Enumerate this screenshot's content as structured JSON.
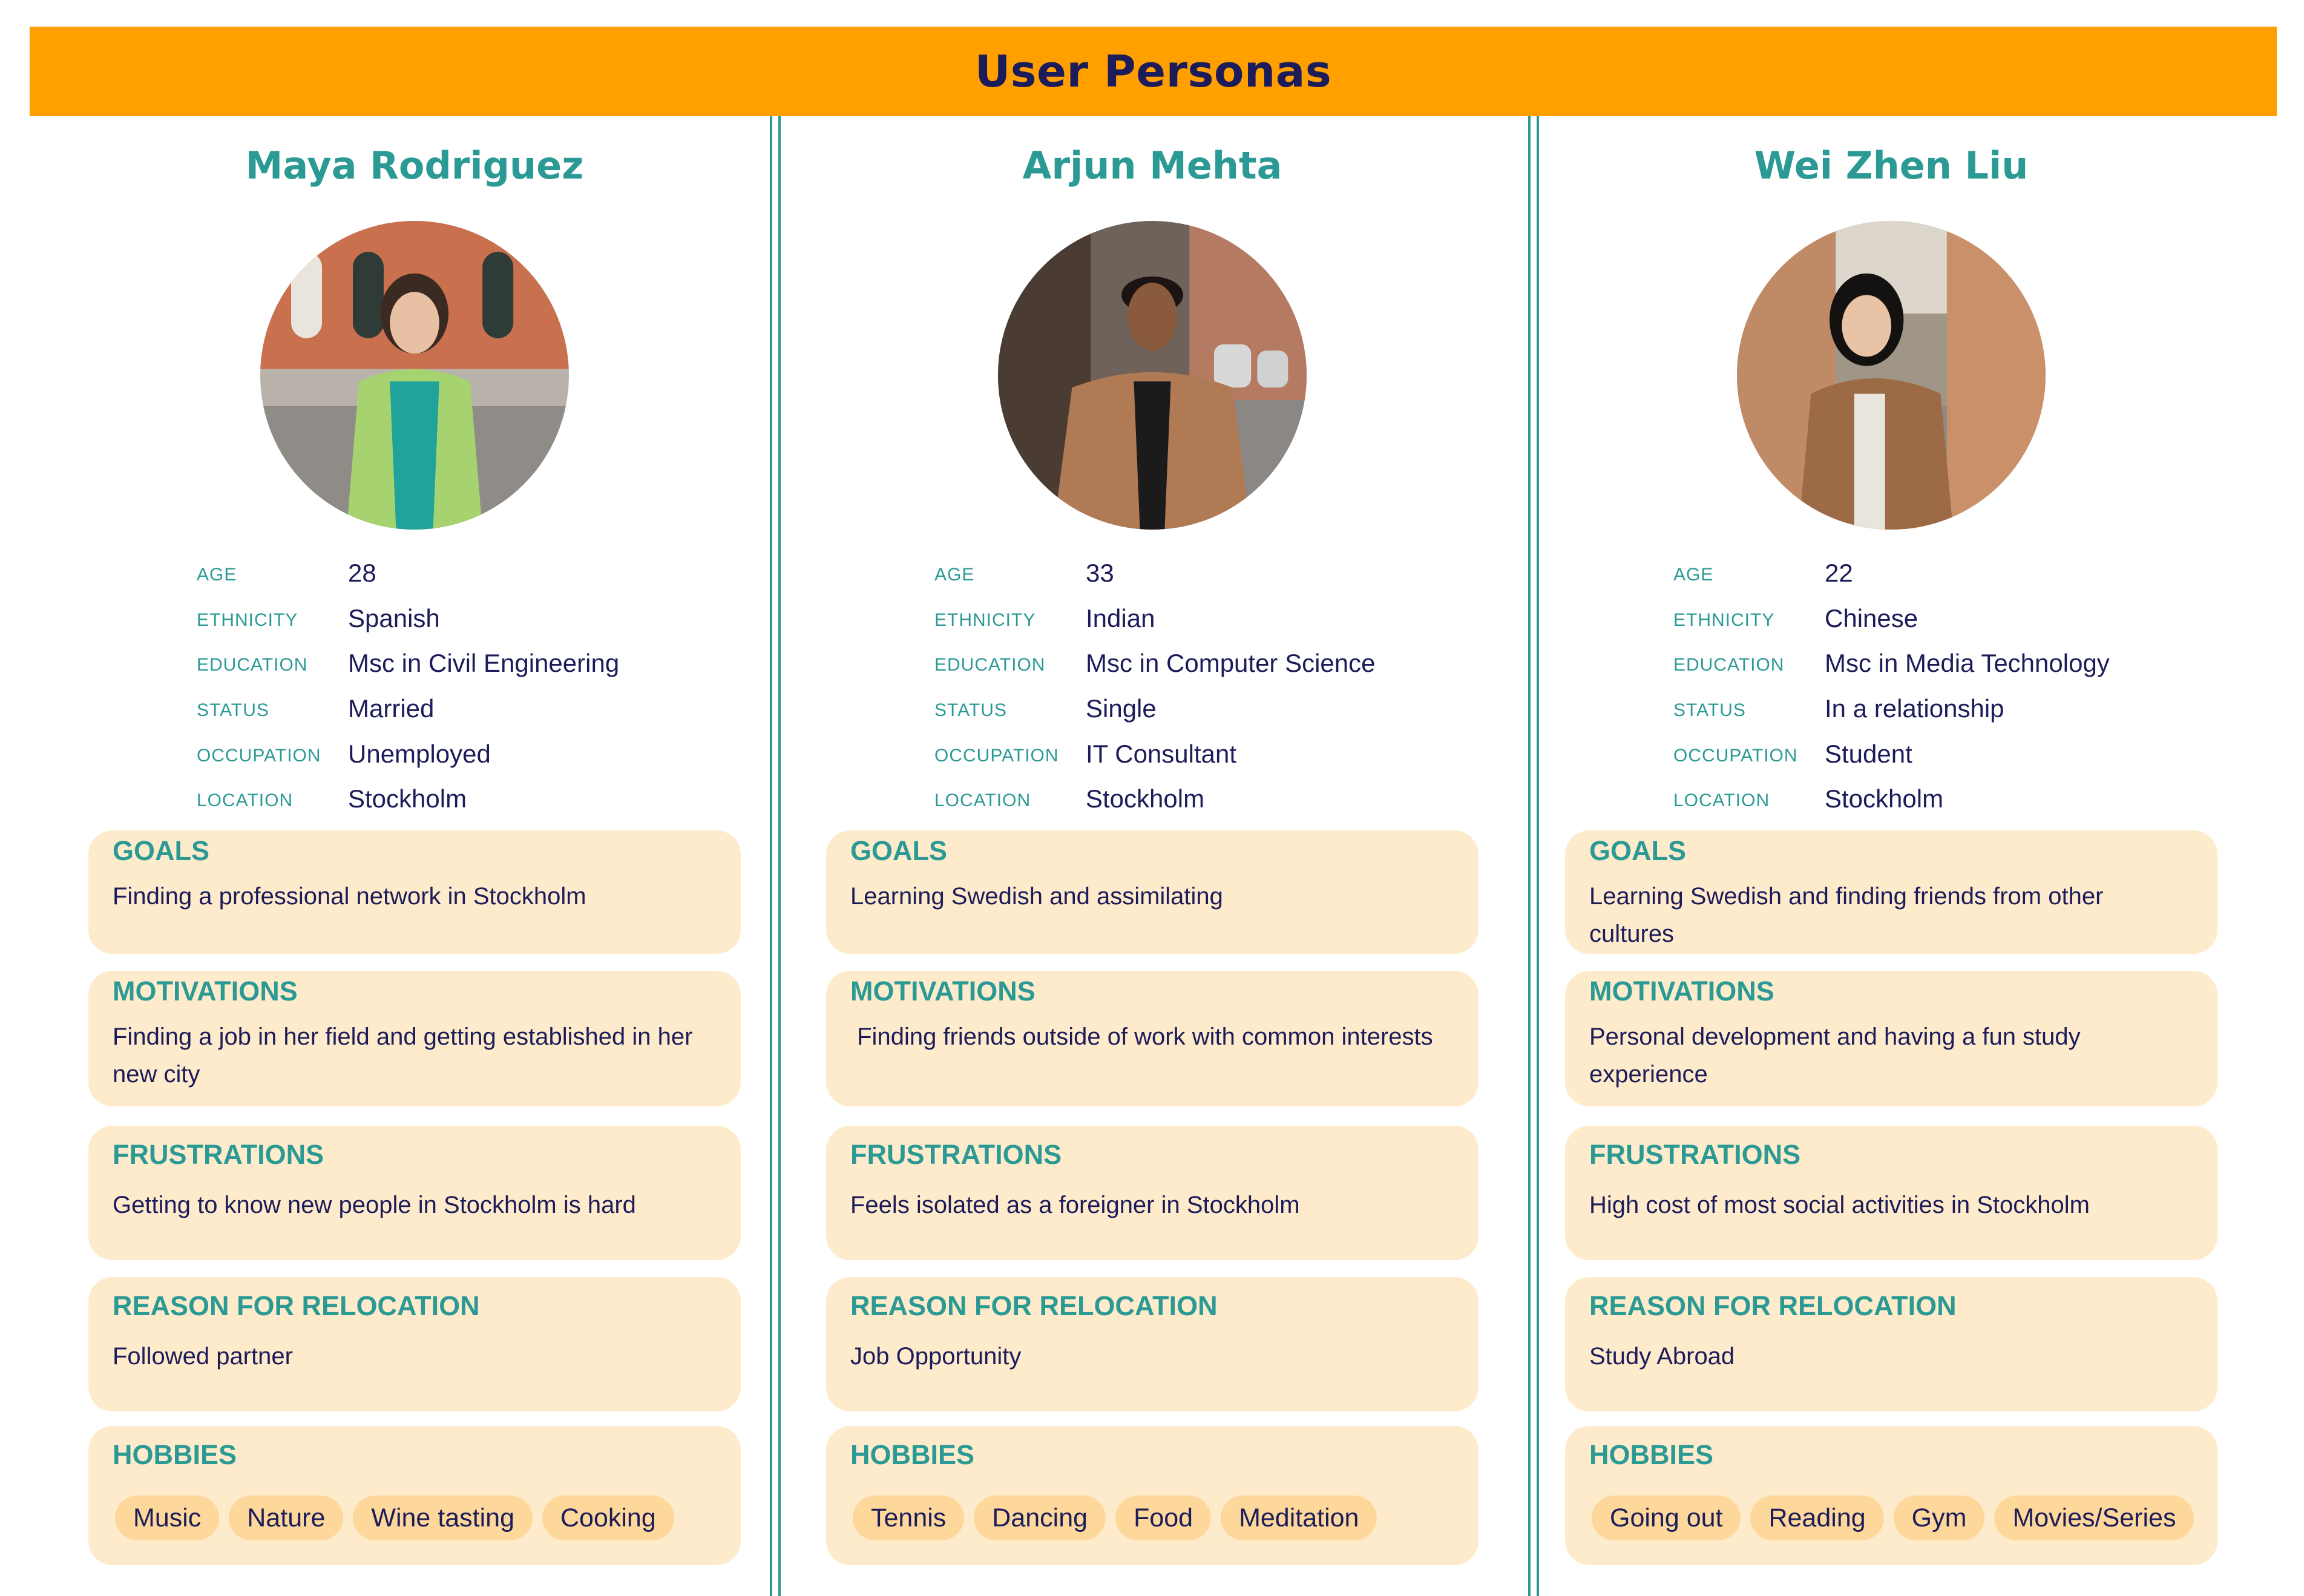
{
  "page": {
    "title": "User Personas",
    "colors": {
      "header_bg": "#ffa000",
      "accent": "#2b9a95",
      "card_bg": "#feebcb",
      "tag_bg": "#fdd89a",
      "text": "#1c1c5a"
    }
  },
  "personas": [
    {
      "name": "Maya Rodriguez",
      "avatar": "photo-woman-street",
      "facts": [
        {
          "label": "AGE",
          "value": "28"
        },
        {
          "label": "ETHNICITY",
          "value": "Spanish"
        },
        {
          "label": "EDUCATION",
          "value": "Msc in Civil Engineering"
        },
        {
          "label": "STATUS",
          "value": "Married"
        },
        {
          "label": "OCCUPATION",
          "value": "Unemployed"
        },
        {
          "label": "LOCATION",
          "value": "Stockholm"
        }
      ],
      "goals": {
        "title": "GOALS",
        "text": "Finding a professional network in Stockholm"
      },
      "motivations": {
        "title": "MOTIVATIONS",
        "text": "Finding a job in her field and getting established in her new city"
      },
      "frustrations": {
        "title": "FRUSTRATIONS",
        "text": "Getting to know new people in Stockholm is hard"
      },
      "relocation": {
        "title": "REASON FOR RELOCATION",
        "text": "Followed partner"
      },
      "hobbies": {
        "title": "HOBBIES",
        "items": [
          "Music",
          "Nature",
          "Wine tasting",
          "Cooking"
        ]
      }
    },
    {
      "name": "Arjun Mehta",
      "avatar": "photo-man-street",
      "facts": [
        {
          "label": "AGE",
          "value": "33"
        },
        {
          "label": "ETHNICITY",
          "value": "Indian"
        },
        {
          "label": "EDUCATION",
          "value": "Msc in Computer Science"
        },
        {
          "label": "STATUS",
          "value": "Single"
        },
        {
          "label": "OCCUPATION",
          "value": "IT Consultant"
        },
        {
          "label": "LOCATION",
          "value": "Stockholm"
        }
      ],
      "goals": {
        "title": "GOALS",
        "text": "Learning Swedish and assimilating"
      },
      "motivations": {
        "title": "MOTIVATIONS",
        "text": " Finding friends outside of work with common interests"
      },
      "frustrations": {
        "title": "FRUSTRATIONS",
        "text": "Feels isolated as a foreigner in Stockholm"
      },
      "relocation": {
        "title": "REASON FOR RELOCATION",
        "text": "Job Opportunity"
      },
      "hobbies": {
        "title": "HOBBIES",
        "items": [
          "Tennis",
          "Dancing",
          "Food",
          "Meditation"
        ]
      }
    },
    {
      "name": "Wei Zhen Liu",
      "avatar": "photo-woman-street",
      "facts": [
        {
          "label": "AGE",
          "value": "22"
        },
        {
          "label": "ETHNICITY",
          "value": "Chinese"
        },
        {
          "label": "EDUCATION",
          "value": "Msc in Media Technology"
        },
        {
          "label": "STATUS",
          "value": "In a relationship"
        },
        {
          "label": "OCCUPATION",
          "value": "Student"
        },
        {
          "label": "LOCATION",
          "value": "Stockholm"
        }
      ],
      "goals": {
        "title": "GOALS",
        "text": "Learning Swedish and finding friends from other cultures"
      },
      "motivations": {
        "title": "MOTIVATIONS",
        "text": "Personal development and having a fun study experience"
      },
      "frustrations": {
        "title": "FRUSTRATIONS",
        "text": "High cost of most social activities in Stockholm"
      },
      "relocation": {
        "title": "REASON FOR RELOCATION",
        "text": "Study Abroad"
      },
      "hobbies": {
        "title": "HOBBIES",
        "items": [
          "Going out",
          "Reading",
          "Gym",
          "Movies/Series"
        ]
      }
    }
  ]
}
